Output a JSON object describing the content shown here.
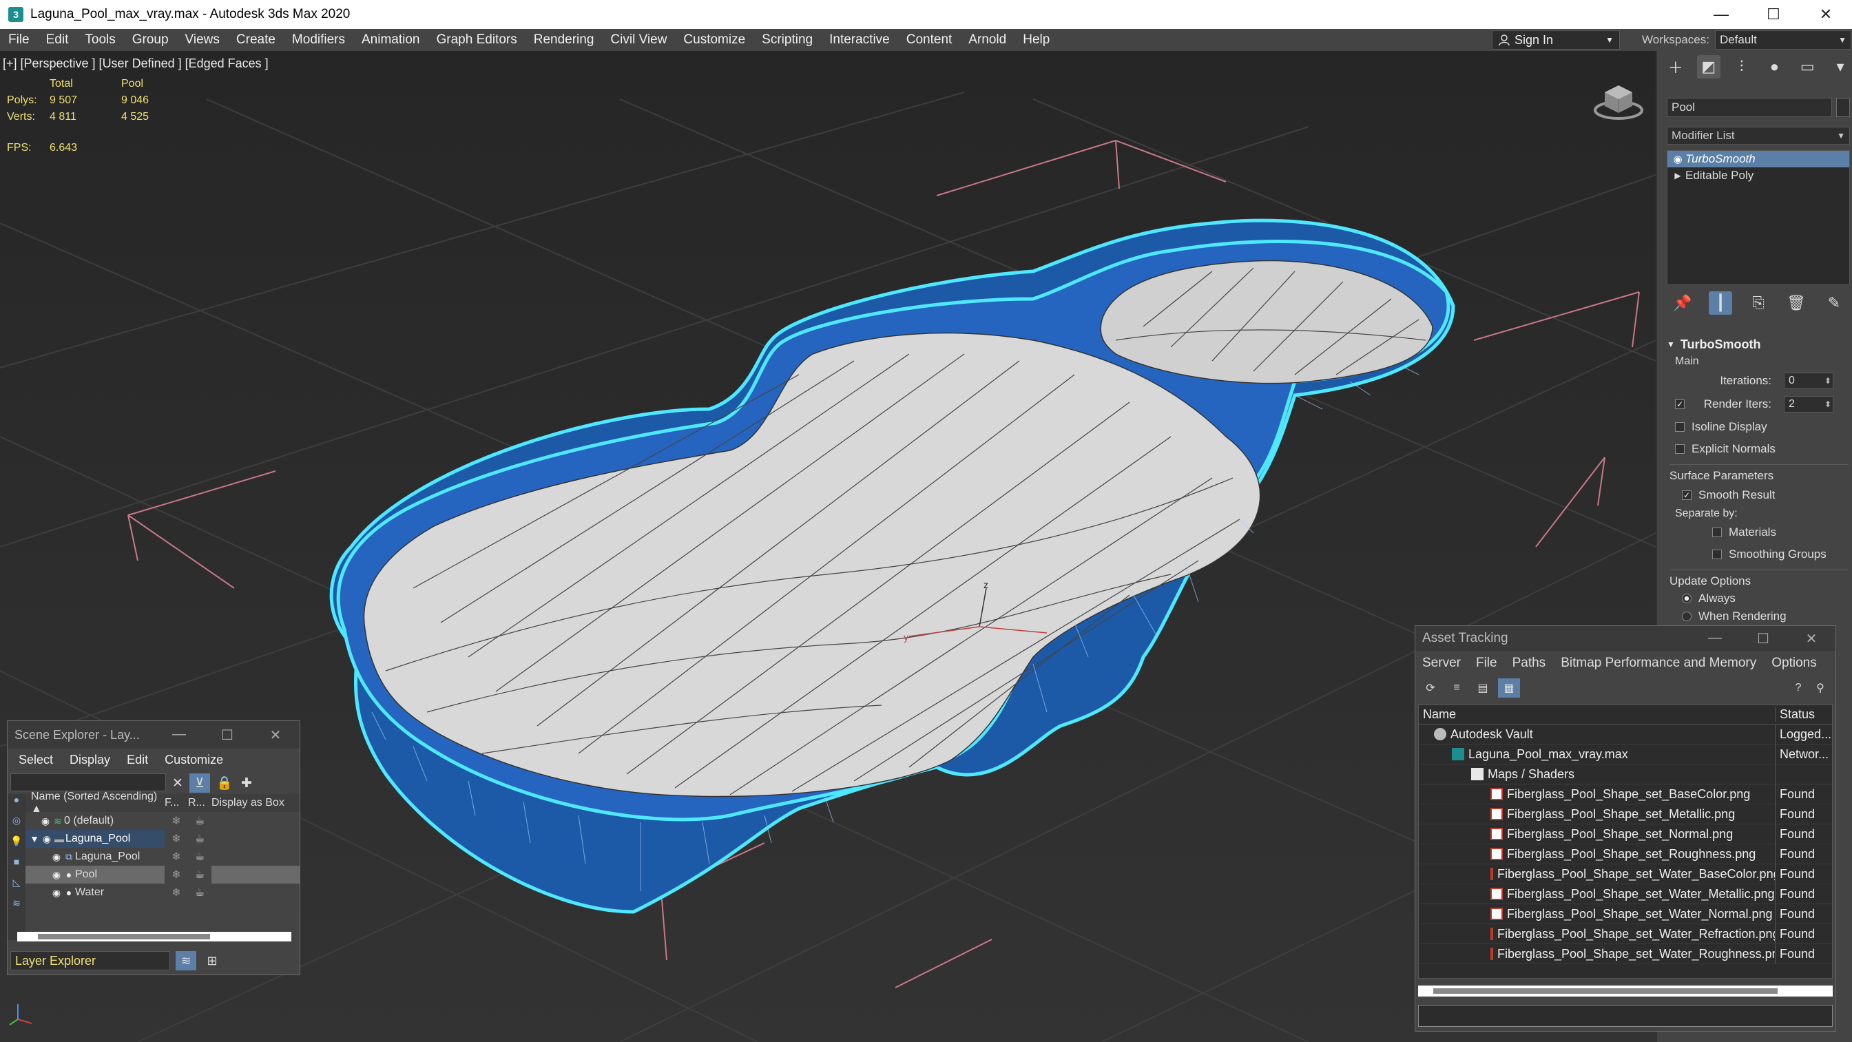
{
  "window": {
    "title": "Laguna_Pool_max_vray.max - Autodesk 3ds Max 2020",
    "minimize": "—",
    "maximize": "☐",
    "close": "✕"
  },
  "menubar": {
    "items": [
      "File",
      "Edit",
      "Tools",
      "Group",
      "Views",
      "Create",
      "Modifiers",
      "Animation",
      "Graph Editors",
      "Rendering",
      "Civil View",
      "Customize",
      "Scripting",
      "Interactive",
      "Content",
      "Arnold",
      "Help"
    ],
    "signin": "Sign In",
    "workspaces_label": "Workspaces:",
    "workspace_value": "Default"
  },
  "viewport": {
    "label": "[+] [Perspective ] [User Defined ] [Edged Faces ]",
    "stats": {
      "header": [
        "",
        "Total",
        "Pool"
      ],
      "polys": [
        "Polys:",
        "9 507",
        "9 046"
      ],
      "verts": [
        "Verts:",
        "4 811",
        "4 525"
      ]
    },
    "fps_label": "FPS:",
    "fps_value": "6.643",
    "colors": {
      "pool_blue": "#1f5fb3",
      "selection_cyan": "#3fe3ff",
      "floor_white": "#d9d9d9",
      "grid": "#3a3a3a",
      "bbox_pink": "#d07a8a"
    }
  },
  "command_panel": {
    "tab_icons": [
      "create-icon",
      "modify-icon",
      "hierarchy-icon",
      "motion-icon",
      "display-icon",
      "utilities-icon"
    ],
    "object_name": "Pool",
    "modifier_list": "Modifier List",
    "stack": [
      {
        "label": "TurboSmooth",
        "selected": true
      },
      {
        "label": "Editable Poly",
        "selected": false
      }
    ],
    "turbosmooth": {
      "title": "TurboSmooth",
      "main_label": "Main",
      "iterations_label": "Iterations:",
      "iterations_value": "0",
      "render_iters_label": "Render Iters:",
      "render_iters_value": "2",
      "isoline_display": "Isoline Display",
      "explicit_normals": "Explicit Normals",
      "surface_params_title": "Surface Parameters",
      "smooth_result": "Smooth Result",
      "separate_by": "Separate by:",
      "materials": "Materials",
      "smoothing_groups": "Smoothing Groups",
      "update_options_title": "Update Options",
      "always": "Always",
      "when_rendering": "When Rendering"
    }
  },
  "scene_explorer": {
    "title": "Scene Explorer - Lay...",
    "menu": [
      "Select",
      "Display",
      "Edit",
      "Customize"
    ],
    "columns": {
      "name": "Name (Sorted Ascending) ▲",
      "f": "F...",
      "r": "R...",
      "box": "Display as Box"
    },
    "rows": [
      {
        "label": "0 (default)",
        "indent": 1,
        "kind": "layer"
      },
      {
        "label": "Laguna_Pool",
        "indent": 0,
        "kind": "layer-parent"
      },
      {
        "label": "Laguna_Pool",
        "indent": 2,
        "kind": "group"
      },
      {
        "label": "Pool",
        "indent": 2,
        "kind": "object-selected"
      },
      {
        "label": "Water",
        "indent": 2,
        "kind": "object"
      }
    ],
    "footer": "Layer Explorer"
  },
  "asset_tracking": {
    "title": "Asset Tracking",
    "menu": [
      "Server",
      "File",
      "Paths",
      "Bitmap Performance and Memory",
      "Options"
    ],
    "columns": {
      "name": "Name",
      "status": "Status"
    },
    "rows": [
      {
        "name": "Autodesk Vault",
        "status": "Logged...",
        "indent": 0,
        "icon": "vault"
      },
      {
        "name": "Laguna_Pool_max_vray.max",
        "status": "Networ...",
        "indent": 1,
        "icon": "maxfile"
      },
      {
        "name": "Maps / Shaders",
        "status": "",
        "indent": 2,
        "icon": "folder"
      },
      {
        "name": "Fiberglass_Pool_Shape_set_BaseColor.png",
        "status": "Found",
        "indent": 3,
        "icon": "png"
      },
      {
        "name": "Fiberglass_Pool_Shape_set_Metallic.png",
        "status": "Found",
        "indent": 3,
        "icon": "png"
      },
      {
        "name": "Fiberglass_Pool_Shape_set_Normal.png",
        "status": "Found",
        "indent": 3,
        "icon": "png"
      },
      {
        "name": "Fiberglass_Pool_Shape_set_Roughness.png",
        "status": "Found",
        "indent": 3,
        "icon": "png"
      },
      {
        "name": "Fiberglass_Pool_Shape_set_Water_BaseColor.png",
        "status": "Found",
        "indent": 3,
        "icon": "png"
      },
      {
        "name": "Fiberglass_Pool_Shape_set_Water_Metallic.png",
        "status": "Found",
        "indent": 3,
        "icon": "png"
      },
      {
        "name": "Fiberglass_Pool_Shape_set_Water_Normal.png",
        "status": "Found",
        "indent": 3,
        "icon": "png"
      },
      {
        "name": "Fiberglass_Pool_Shape_set_Water_Refraction.png",
        "status": "Found",
        "indent": 3,
        "icon": "png"
      },
      {
        "name": "Fiberglass_Pool_Shape_set_Water_Roughness.png",
        "status": "Found",
        "indent": 3,
        "icon": "png"
      }
    ]
  }
}
